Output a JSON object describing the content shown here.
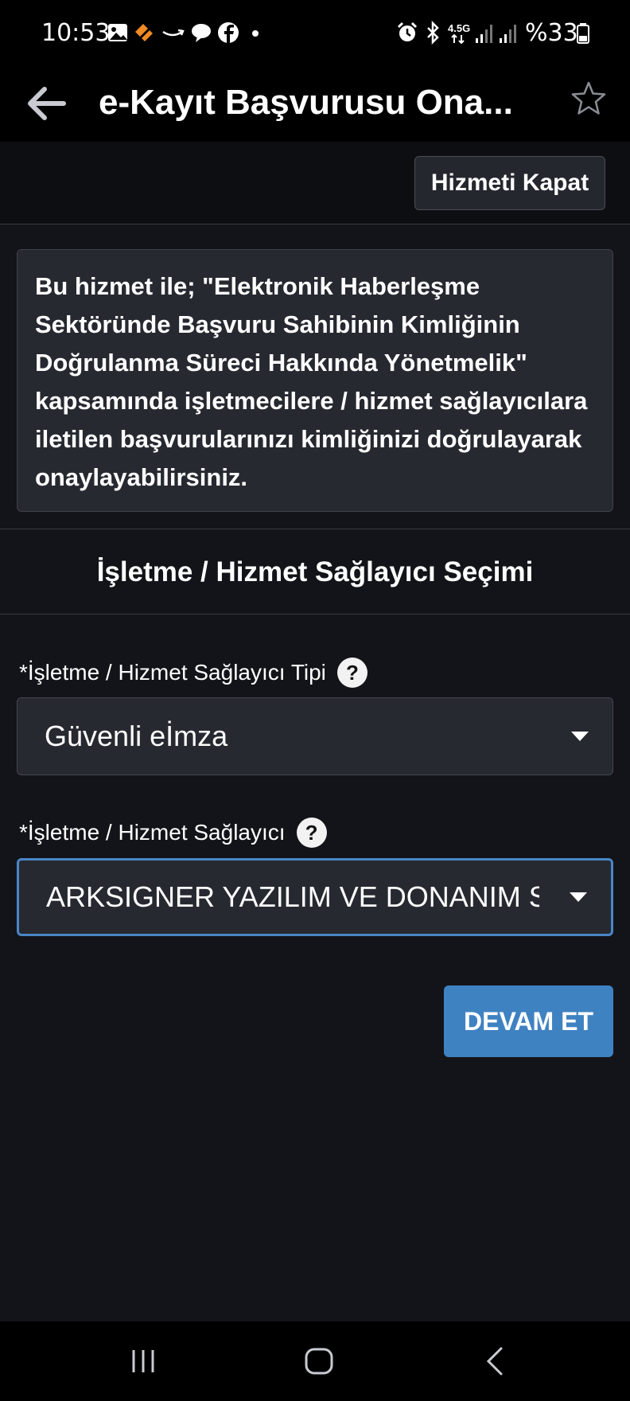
{
  "status_bar": {
    "time": "10:53",
    "battery_text": "%33",
    "network_label": "4.5G",
    "left_icons": [
      "gallery-icon",
      "deal-app-icon",
      "amazon-icon",
      "chat-bubble-icon",
      "facebook-icon",
      "dot-icon"
    ],
    "right_icons": [
      "alarm-icon",
      "bluetooth-icon",
      "network-4-5g-icon",
      "signal-icon",
      "signal-icon",
      "battery-icon"
    ]
  },
  "header": {
    "title": "e-Kayıt Başvurusu Ona...",
    "back_icon": "arrow-left-icon",
    "favorite_icon": "star-outline-icon"
  },
  "actions": {
    "close_service_label": "Hizmeti Kapat"
  },
  "info": {
    "text": "Bu hizmet ile; \"Elektronik Haberleşme Sektöründe Başvuru Sahibinin Kimliğinin Doğrulanma Süreci Hakkında Yönetmelik\" kapsamında işletmecilere / hizmet sağlayıcılara iletilen başvurularınızı kimliğinizi doğrulayarak onaylayabilirsiniz."
  },
  "section": {
    "title": "İşletme / Hizmet Sağlayıcı Seçimi"
  },
  "form": {
    "type_field": {
      "label": "*İşletme / Hizmet Sağlayıcı Tipi",
      "help": "?",
      "value": "Güvenli eİmza"
    },
    "provider_field": {
      "label": "*İşletme / Hizmet Sağlayıcı",
      "help": "?",
      "value": "ARKSIGNER YAZILIM VE DONANIM S"
    },
    "continue_label": "DEVAM ET"
  },
  "nav_bar": {
    "icons": [
      "recent-apps-icon",
      "home-icon",
      "back-nav-icon"
    ]
  },
  "colors": {
    "background": "#131419",
    "bar_background": "#000000",
    "panel": "#262930",
    "accent": "#3f82c2",
    "focus_border": "#4a86c7"
  }
}
